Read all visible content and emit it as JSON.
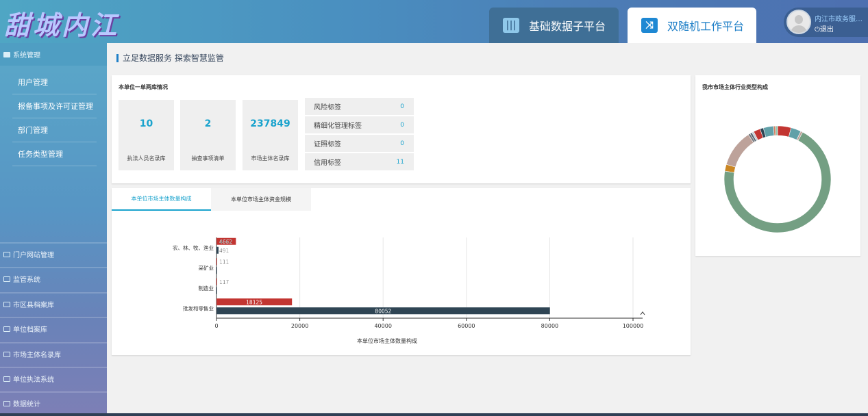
{
  "header": {
    "logo": "甜城内江",
    "tabs": [
      {
        "label": "基础数据子平台",
        "icon": "bar-chart-icon"
      },
      {
        "label": "双随机工作平台",
        "icon": "shuffle-icon"
      }
    ],
    "user_name": "内江市政务服务...",
    "logout": "退出"
  },
  "sidebar": {
    "open_group": "系统管理",
    "items": [
      "用户管理",
      "报备事项及许可证管理",
      "部门管理",
      "任务类型管理"
    ],
    "groups": [
      "门户网站管理",
      "监管系统",
      "市区县档案库",
      "单位档案库",
      "市场主体名录库",
      "单位执法系统",
      "数据统计"
    ]
  },
  "breadcrumb": "立足数据服务 探索智慧监管",
  "overview": {
    "title": "本单位一单两库情况",
    "cards": [
      {
        "value": "10",
        "label": "执法人员名录库"
      },
      {
        "value": "2",
        "label": "抽查事项清单"
      },
      {
        "value": "237849",
        "label": "市场主体名录库"
      }
    ],
    "tags": [
      {
        "name": "风险标签",
        "value": "0"
      },
      {
        "name": "精细化管理标签",
        "value": "0"
      },
      {
        "name": "证照标签",
        "value": "0"
      },
      {
        "name": "信用标签",
        "value": "11"
      }
    ]
  },
  "tabs_panel": {
    "tabs": [
      "本单位市场主体数量构成",
      "本单位市场主体资金规模"
    ]
  },
  "chart_data": [
    {
      "type": "bar",
      "orientation": "horizontal",
      "xlabel": "本单位市场主体数量构成",
      "categories": [
        "农、林、牧、渔业",
        "采矿业",
        "制造业",
        "批发和零售业"
      ],
      "xlim": [
        0,
        100000
      ],
      "xticks": [
        "0",
        "20000",
        "40000",
        "60000",
        "80000",
        "100000"
      ],
      "series": [
        {
          "color": "#c23531",
          "values": [
            4662,
            111,
            117,
            18125
          ]
        },
        {
          "color": "#2f4554",
          "values": [
            491,
            4,
            4,
            80052
          ]
        }
      ],
      "bar_labels": [
        [
          "4662",
          "111",
          "117",
          "18125"
        ],
        [
          "491",
          "",
          "",
          "80052"
        ]
      ]
    },
    {
      "type": "pie",
      "title": "我市市场主体行业类型构成",
      "donut": true,
      "slices": [
        {
          "color": "#c23531",
          "value": 4
        },
        {
          "color": "#61a0a8",
          "value": 3
        },
        {
          "color": "#bda29a",
          "value": 0.6
        },
        {
          "color": "#749f83",
          "value": 68
        },
        {
          "color": "#ca8622",
          "value": 2
        },
        {
          "color": "#bda29a",
          "value": 11
        },
        {
          "color": "#6e7074",
          "value": 0.6
        },
        {
          "color": "#546570",
          "value": 0.6
        },
        {
          "color": "#c4ccd3",
          "value": 0.6
        },
        {
          "color": "#c23531",
          "value": 2
        },
        {
          "color": "#2f4554",
          "value": 1
        },
        {
          "color": "#61a0a8",
          "value": 3
        },
        {
          "color": "#d48265",
          "value": 0.6
        },
        {
          "color": "#91c7ae",
          "value": 0.6
        }
      ]
    }
  ]
}
